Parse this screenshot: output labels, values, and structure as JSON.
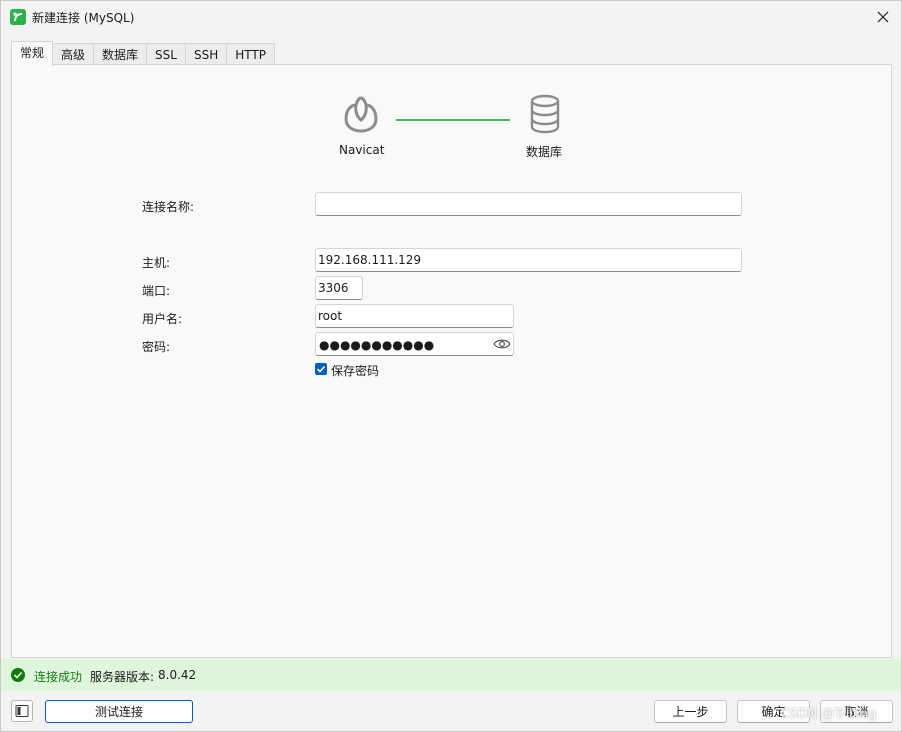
{
  "window": {
    "title": "新建连接 (MySQL)"
  },
  "tabs": [
    {
      "label": "常规",
      "active": true
    },
    {
      "label": "高级",
      "active": false
    },
    {
      "label": "数据库",
      "active": false
    },
    {
      "label": "SSL",
      "active": false
    },
    {
      "label": "SSH",
      "active": false
    },
    {
      "label": "HTTP",
      "active": false
    }
  ],
  "diagram": {
    "left_label": "Navicat",
    "right_label": "数据库"
  },
  "form": {
    "connection_name_label": "连接名称:",
    "connection_name_value": "",
    "host_label": "主机:",
    "host_value": "192.168.111.129",
    "port_label": "端口:",
    "port_value": "3306",
    "username_label": "用户名:",
    "username_value": "root",
    "password_label": "密码:",
    "password_mask": "●●●●●●●●●●●",
    "save_password_label": "保存密码",
    "save_password_checked": true
  },
  "status": {
    "success_text": "连接成功",
    "version_label": "服务器版本:",
    "version_value": "8.0.42"
  },
  "buttons": {
    "test_connection": "测试连接",
    "previous": "上一步",
    "ok": "确定",
    "cancel": "取消"
  },
  "watermark": "CSDN @Trilling",
  "colors": {
    "accent": "#005fb8",
    "success": "#107c10",
    "success_bg": "#dff6dd",
    "connector": "#3bbf56"
  }
}
